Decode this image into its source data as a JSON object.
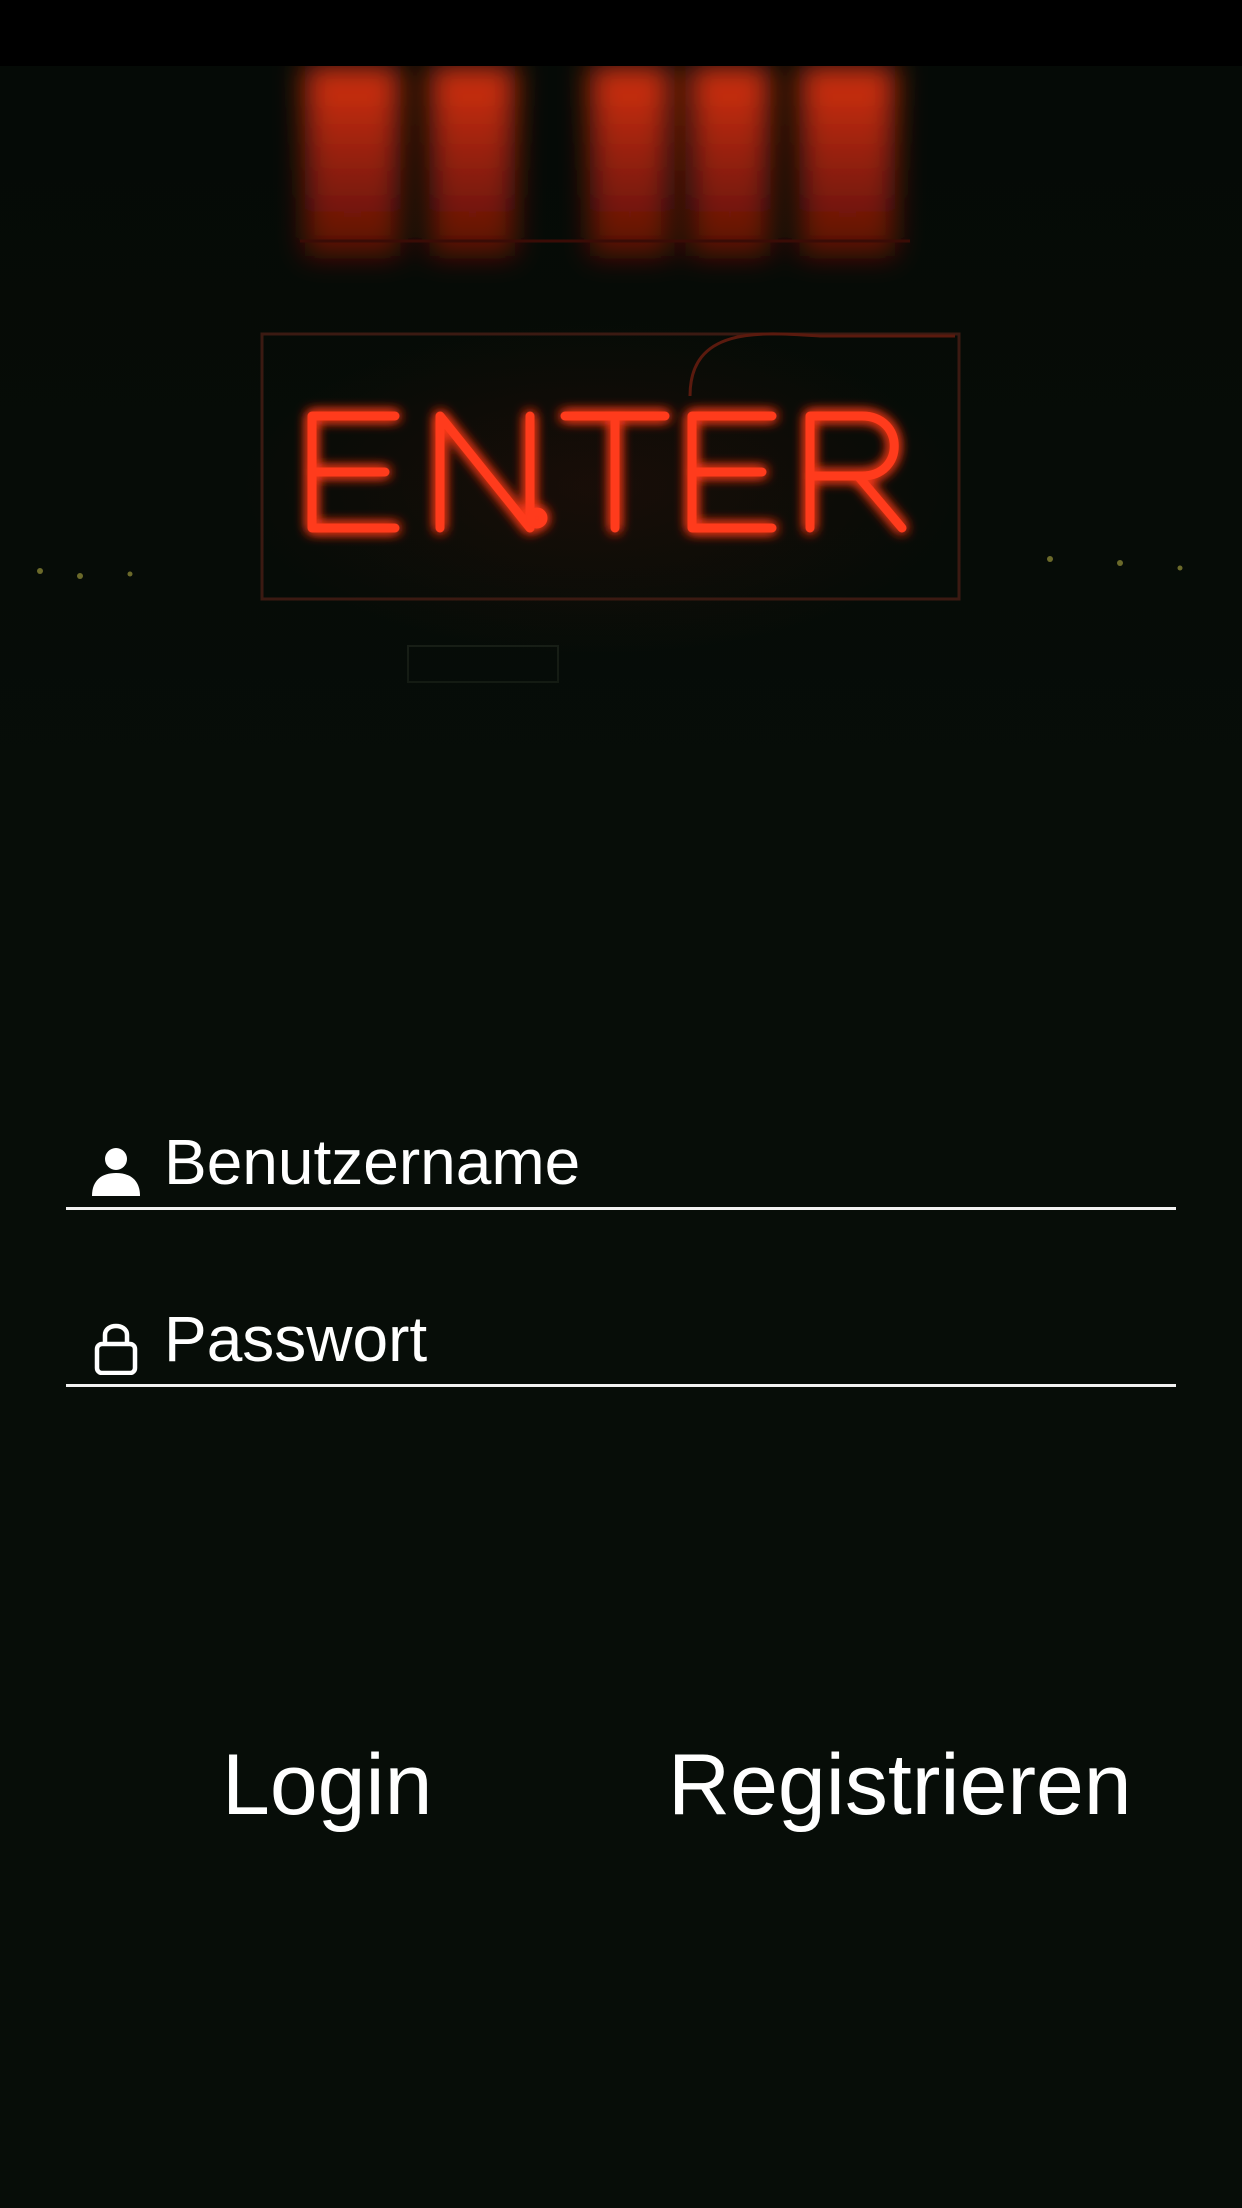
{
  "hero": {
    "neon_text": "ENTER",
    "neon_color": "#ff3a1c"
  },
  "form": {
    "username": {
      "placeholder": "Benutzername",
      "value": "",
      "icon": "user-icon"
    },
    "password": {
      "placeholder": "Passwort",
      "value": "",
      "icon": "lock-icon"
    }
  },
  "actions": {
    "login_label": "Login",
    "register_label": "Registrieren"
  },
  "colors": {
    "background": "#070d08",
    "text": "#ffffff",
    "underline": "#f2f2f2"
  }
}
